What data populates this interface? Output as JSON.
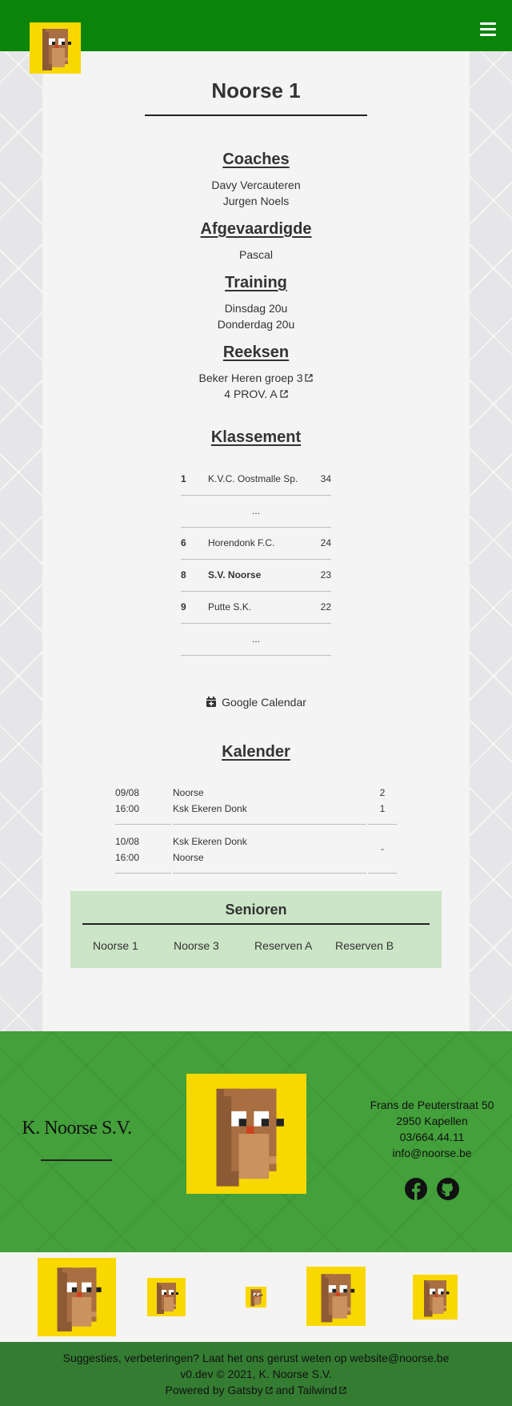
{
  "header": {
    "menu_icon": "hamburger-menu-icon",
    "logo_icon": "squirrel-pixel-logo",
    "bar_color": "#0a850a"
  },
  "team": {
    "title": "Noorse 1",
    "coaches_heading": "Coaches",
    "coaches": [
      "Davy Vercauteren",
      "Jurgen Noels"
    ],
    "delegate_heading": "Afgevaardigde",
    "delegate": "Pascal",
    "training_heading": "Training",
    "training": [
      "Dinsdag 20u",
      "Donderdag 20u"
    ],
    "series_heading": "Reeksen",
    "series": [
      "Beker Heren groep 3",
      "4 PROV. A"
    ]
  },
  "ranking": {
    "heading": "Klassement",
    "rows": [
      {
        "pos": "1",
        "team": "K.V.C. Oostmalle Sp.",
        "points": "34"
      },
      {
        "gap": "..."
      },
      {
        "pos": "6",
        "team": "Horendonk F.C.",
        "points": "24"
      },
      {
        "pos": "8",
        "team": "S.V. Noorse",
        "points": "23",
        "highlight": true
      },
      {
        "pos": "9",
        "team": "Putte S.K.",
        "points": "22"
      },
      {
        "gap": "..."
      }
    ]
  },
  "calendar_link": {
    "label": "Google Calendar",
    "icon": "calendar-plus-icon"
  },
  "calendar": {
    "heading": "Kalender",
    "matches": [
      {
        "date": "09/08",
        "time": "16:00",
        "home": "Noorse",
        "away": "Ksk Ekeren Donk",
        "home_score": "2",
        "away_score": "1"
      },
      {
        "date": "10/08",
        "time": "16:00",
        "home": "Ksk Ekeren Donk",
        "away": "Noorse",
        "result": "-"
      }
    ]
  },
  "senioren": {
    "heading": "Senioren",
    "links": [
      "Noorse 1",
      "Noorse 3",
      "Reserven A",
      "Reserven B"
    ],
    "bg_color": "#cbe5c6"
  },
  "footer": {
    "club_name": "K. Noorse S.V.",
    "address": [
      "Frans de Peuterstraat 50",
      "2950 Kapellen",
      "03/664.44.11"
    ],
    "email": "info@noorse.be",
    "social_icons": [
      "facebook-icon",
      "github-icon"
    ],
    "bg_color": "#43a03a"
  },
  "bottom": {
    "suggestion_text": "Suggesties, verbeteringen? Laat het ons gerust weten op",
    "suggestion_email": "website@noorse.be",
    "version_text": "v0.dev © 2021, K. Noorse S.V.",
    "powered_prefix": "Powered by",
    "gatsby": "Gatsby",
    "and_text": "and",
    "tailwind": "Tailwind"
  }
}
